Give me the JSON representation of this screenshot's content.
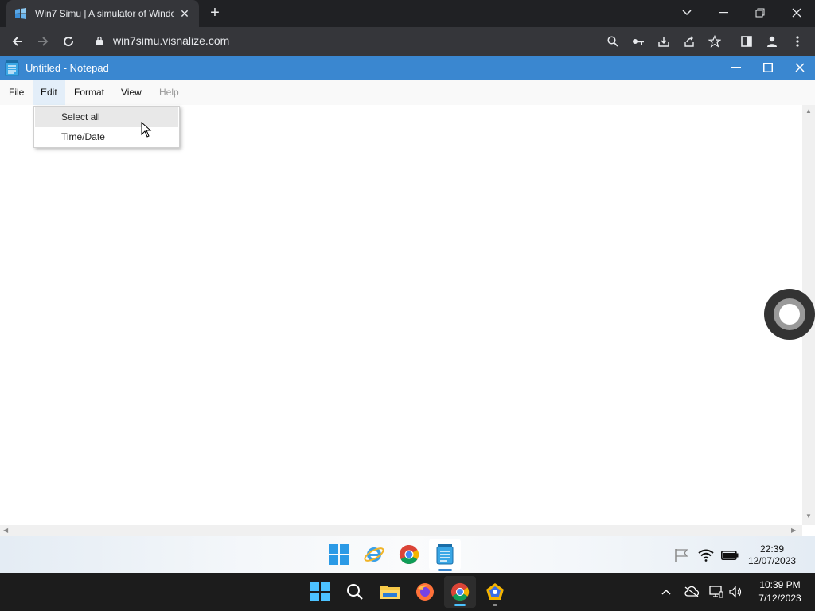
{
  "browser": {
    "tab_title": "Win7 Simu | A simulator of Windows 7",
    "url": "win7simu.visnalize.com"
  },
  "notepad": {
    "title": "Untitled - Notepad",
    "menu": {
      "file": "File",
      "edit": "Edit",
      "format": "Format",
      "view": "View",
      "help": "Help"
    },
    "edit_dropdown": {
      "items": [
        {
          "label": "Select all"
        },
        {
          "label": "Time/Date"
        }
      ]
    },
    "content": ""
  },
  "sim_taskbar": {
    "apps": [
      "windows-start",
      "internet-explorer",
      "chrome",
      "notepad"
    ],
    "active_app": "notepad",
    "time": "22:39",
    "date": "12/07/2023"
  },
  "os_taskbar": {
    "apps": [
      "start",
      "search",
      "file-explorer",
      "firefox",
      "chrome",
      "other-app"
    ],
    "active_app": "chrome",
    "time": "10:39 PM",
    "date": "7/12/2023"
  },
  "colors": {
    "notepad_titlebar": "#3a87d0",
    "browser_chrome": "#35363a",
    "os_taskbar": "#1c1c1c"
  }
}
